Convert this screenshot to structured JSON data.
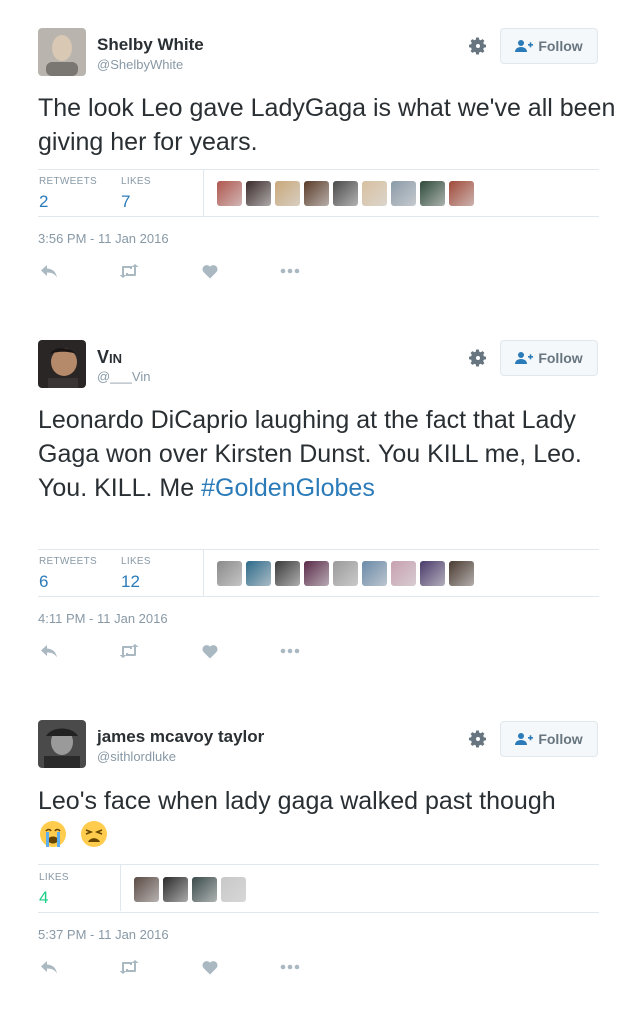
{
  "tweets": [
    {
      "name": "Shelby White",
      "handle": "@ShelbyWhite",
      "follow_label": "Follow",
      "text": "The look Leo gave LadyGaga is what we've all been giving her for years.",
      "stats": [
        {
          "label": "RETWEETS",
          "value": "2"
        },
        {
          "label": "LIKES",
          "value": "7"
        }
      ],
      "liker_colors": [
        "#b0564e",
        "#3a2a2a",
        "#c9a87a",
        "#5a3b28",
        "#4a4a4a",
        "#d8c0a0",
        "#8a9aa8",
        "#2e4a3a",
        "#a04a3a"
      ],
      "timestamp": "3:56 PM - 11 Jan 2016"
    },
    {
      "name": "Vin",
      "handle": "@___Vin",
      "follow_label": "Follow",
      "text": "Leonardo DiCaprio laughing at the fact that Lady Gaga won over Kirsten Dunst. You KILL me, Leo. You. KILL. Me",
      "hashtag": "#GoldenGlobes",
      "stats": [
        {
          "label": "RETWEETS",
          "value": "6"
        },
        {
          "label": "LIKES",
          "value": "12"
        }
      ],
      "liker_colors": [
        "#8a8a8a",
        "#2c6a8a",
        "#3a3a3a",
        "#5a2a4a",
        "#9a9a9a",
        "#6a8aa8",
        "#c8a0b0",
        "#4a3a6a",
        "#4a3a30"
      ],
      "timestamp": "4:11 PM - 11 Jan 2016"
    },
    {
      "name": "james mcavoy taylor",
      "handle": "@sithlordluke",
      "follow_label": "Follow",
      "text": "Leo's face when lady gaga walked past though",
      "emojis": [
        "loudly-crying-face",
        "weary-face"
      ],
      "stats": [
        {
          "label": "LIKES",
          "value": "4"
        }
      ],
      "liker_colors": [
        "#5a4a44",
        "#2a2a2a",
        "#3a4a4a",
        "#c8c8c8"
      ],
      "timestamp": "5:37 PM - 11 Jan 2016"
    }
  ],
  "colors": {
    "link": "#2b7bb9",
    "muted": "#8899a6",
    "likes_green": "#19cf86",
    "icon_gray": "#aab8c2"
  },
  "icons": [
    "gear-icon",
    "follow-person-plus-icon",
    "reply-icon",
    "retweet-icon",
    "heart-icon",
    "more-dots-icon"
  ]
}
